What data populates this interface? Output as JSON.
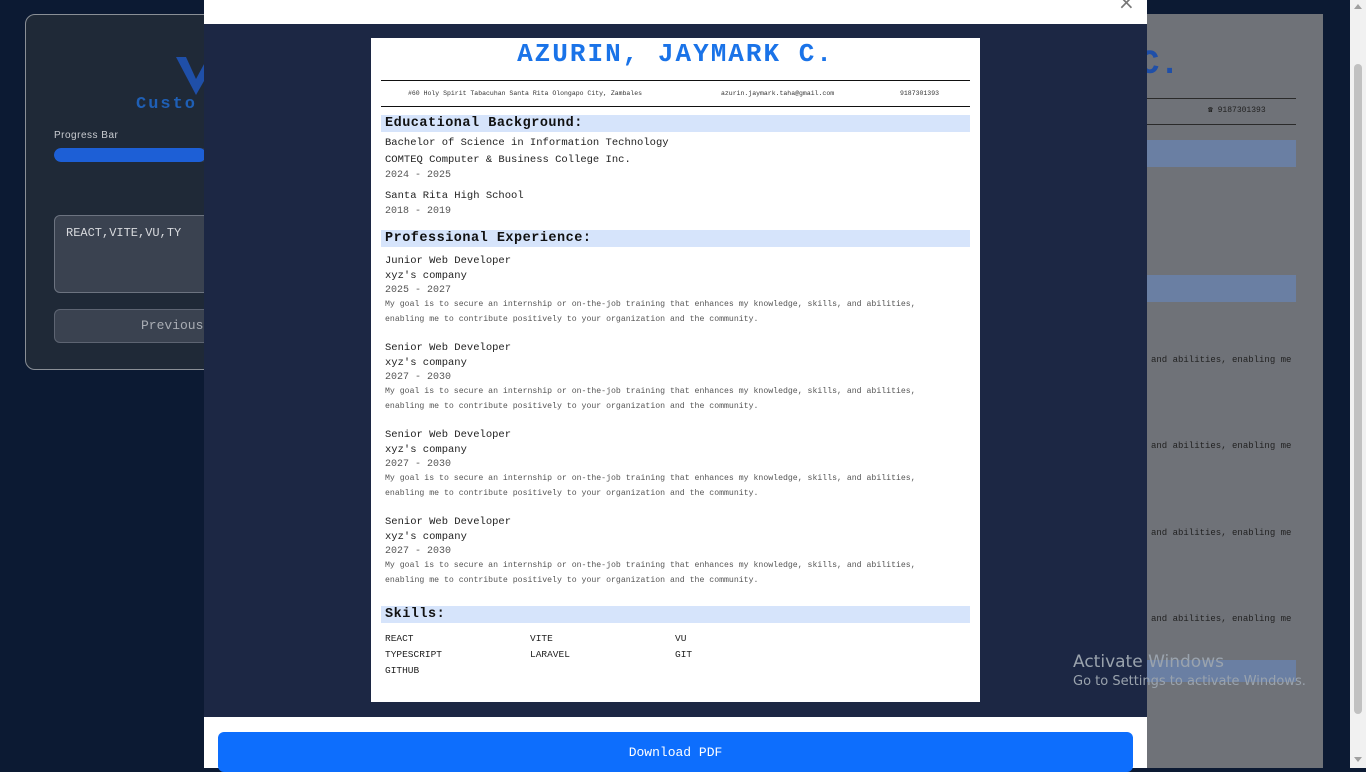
{
  "background": {
    "brand": "Custo",
    "progress_label": "Progress Bar",
    "progress_fraction": 0.8,
    "textarea_value": "REACT,VITE,VU,TY",
    "previous_label": "Previous",
    "right_letter": "C.",
    "right_phone": "☎ 9187301393",
    "right_snippets": [
      "and abilities, enabling me",
      "and abilities, enabling me",
      "and abilities, enabling me",
      "and abilities, enabling me"
    ]
  },
  "modal": {
    "close_glyph": "×",
    "download_label": "Download PDF"
  },
  "resume": {
    "name": "AZURIN, JAYMARK C.",
    "address": "#60 Holy Spirit Tabacuhan Santa Rita Olongapo City, Zambales",
    "email": "azurin.jaymark.taha@gmail.com",
    "phone": "9187301393",
    "education_heading": "Educational Background:",
    "education": [
      {
        "degree": "Bachelor of Science in Information Technology",
        "school": "COMTEQ Computer & Business College Inc.",
        "years": "2024 - 2025"
      },
      {
        "school": "Santa Rita High School",
        "years": "2018 - 2019"
      }
    ],
    "experience_heading": "Professional Experience:",
    "experience": [
      {
        "title": "Junior Web Developer",
        "company": "xyz's company",
        "years": "2025 - 2027",
        "description": "My goal is to secure an internship or on-the-job training that enhances my knowledge, skills, and abilities, enabling me to contribute positively to your organization and the community."
      },
      {
        "title": "Senior Web Developer",
        "company": "xyz's company",
        "years": "2027 - 2030",
        "description": "My goal is to secure an internship or on-the-job training that enhances my knowledge, skills, and abilities, enabling me to contribute positively to your organization and the community."
      },
      {
        "title": "Senior Web Developer",
        "company": "xyz's company",
        "years": "2027 - 2030",
        "description": "My goal is to secure an internship or on-the-job training that enhances my knowledge, skills, and abilities, enabling me to contribute positively to your organization and the community."
      },
      {
        "title": "Senior Web Developer",
        "company": "xyz's company",
        "years": "2027 - 2030",
        "description": "My goal is to secure an internship or on-the-job training that enhances my knowledge, skills, and abilities, enabling me to contribute positively to your organization and the community."
      }
    ],
    "skills_heading": "Skills:",
    "skills": [
      "REACT",
      "VITE",
      "VU",
      "TYPESCRIPT",
      "LARAVEL",
      "GIT",
      "GITHUB"
    ]
  },
  "os_watermark": {
    "line1": "Activate Windows",
    "line2": "Go to Settings to activate Windows."
  },
  "colors": {
    "accent": "#1a73e8",
    "button": "#0d6efd",
    "section_band": "#d6e4fb",
    "modal_backdrop": "#1c2744"
  }
}
